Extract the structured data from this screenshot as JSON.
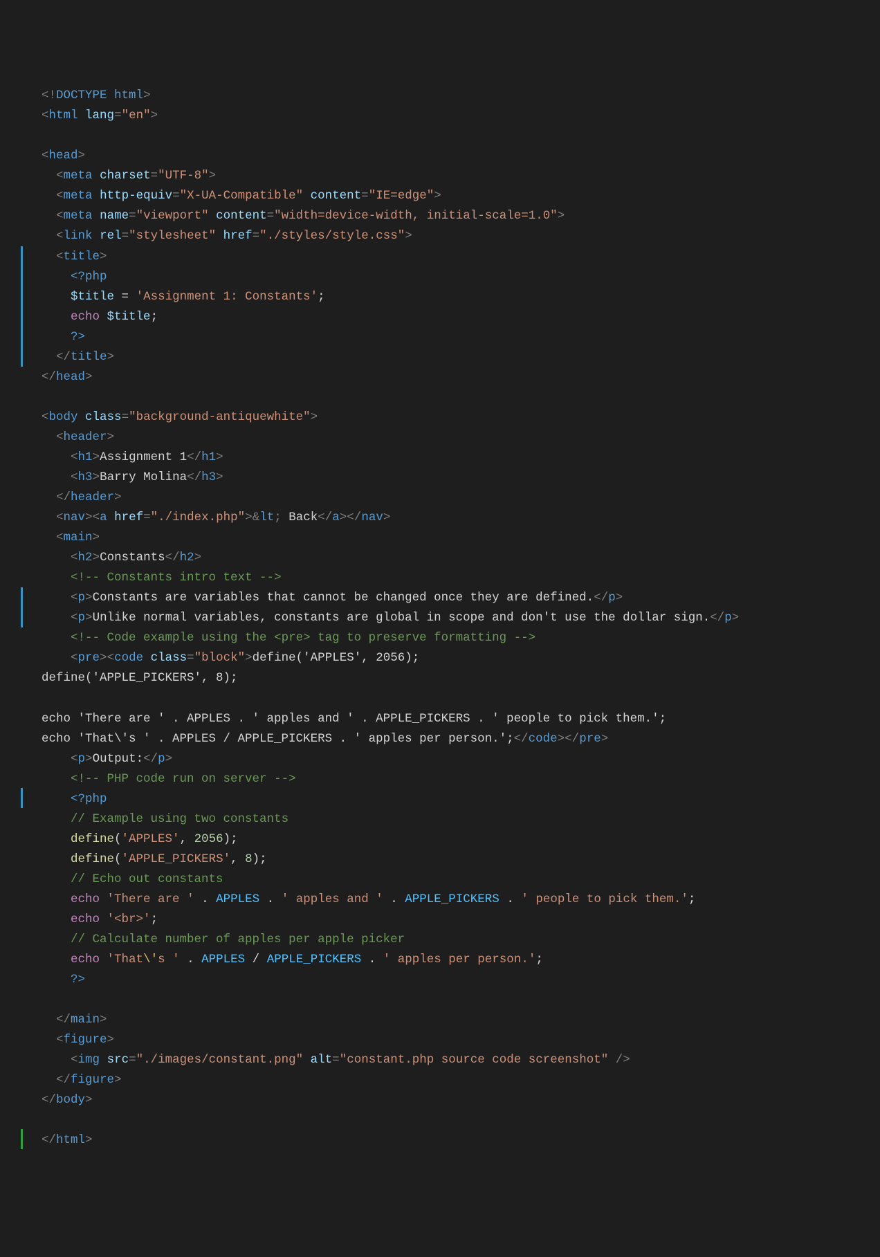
{
  "lines": [
    {
      "i": 0,
      "seg": [
        [
          "t-punc",
          "<!"
        ],
        [
          "t-doct",
          "DOCTYPE"
        ],
        [
          "t-text",
          " "
        ],
        [
          "t-doct",
          "html"
        ],
        [
          "t-punc",
          ">"
        ]
      ]
    },
    {
      "i": 0,
      "seg": [
        [
          "t-punc",
          "<"
        ],
        [
          "t-tag",
          "html"
        ],
        [
          "t-text",
          " "
        ],
        [
          "t-attr",
          "lang"
        ],
        [
          "t-punc",
          "="
        ],
        [
          "t-str",
          "\"en\""
        ],
        [
          "t-punc",
          ">"
        ]
      ]
    },
    {
      "i": 0,
      "seg": []
    },
    {
      "i": 0,
      "seg": [
        [
          "t-punc",
          "<"
        ],
        [
          "t-tag",
          "head"
        ],
        [
          "t-punc",
          ">"
        ]
      ]
    },
    {
      "i": 1,
      "seg": [
        [
          "t-punc",
          "<"
        ],
        [
          "t-tag",
          "meta"
        ],
        [
          "t-text",
          " "
        ],
        [
          "t-attr",
          "charset"
        ],
        [
          "t-punc",
          "="
        ],
        [
          "t-str",
          "\"UTF-8\""
        ],
        [
          "t-punc",
          ">"
        ]
      ]
    },
    {
      "i": 1,
      "seg": [
        [
          "t-punc",
          "<"
        ],
        [
          "t-tag",
          "meta"
        ],
        [
          "t-text",
          " "
        ],
        [
          "t-attr",
          "http-equiv"
        ],
        [
          "t-punc",
          "="
        ],
        [
          "t-str",
          "\"X-UA-Compatible\""
        ],
        [
          "t-text",
          " "
        ],
        [
          "t-attr",
          "content"
        ],
        [
          "t-punc",
          "="
        ],
        [
          "t-str",
          "\"IE=edge\""
        ],
        [
          "t-punc",
          ">"
        ]
      ]
    },
    {
      "i": 1,
      "seg": [
        [
          "t-punc",
          "<"
        ],
        [
          "t-tag",
          "meta"
        ],
        [
          "t-text",
          " "
        ],
        [
          "t-attr",
          "name"
        ],
        [
          "t-punc",
          "="
        ],
        [
          "t-str",
          "\"viewport\""
        ],
        [
          "t-text",
          " "
        ],
        [
          "t-attr",
          "content"
        ],
        [
          "t-punc",
          "="
        ],
        [
          "t-str",
          "\"width=device-width, initial-scale=1.0\""
        ],
        [
          "t-punc",
          ">"
        ]
      ]
    },
    {
      "i": 1,
      "seg": [
        [
          "t-punc",
          "<"
        ],
        [
          "t-tag",
          "link"
        ],
        [
          "t-text",
          " "
        ],
        [
          "t-attr",
          "rel"
        ],
        [
          "t-punc",
          "="
        ],
        [
          "t-str",
          "\"stylesheet\""
        ],
        [
          "t-text",
          " "
        ],
        [
          "t-attr",
          "href"
        ],
        [
          "t-punc",
          "="
        ],
        [
          "t-str",
          "\"./styles/style.css\""
        ],
        [
          "t-punc",
          ">"
        ]
      ]
    },
    {
      "i": 1,
      "seg": [
        [
          "t-punc",
          "<"
        ],
        [
          "t-tag",
          "title"
        ],
        [
          "t-punc",
          ">"
        ]
      ]
    },
    {
      "i": 2,
      "seg": [
        [
          "t-php",
          "<?php"
        ]
      ]
    },
    {
      "i": 2,
      "seg": [
        [
          "t-var",
          "$title"
        ],
        [
          "t-text",
          " "
        ],
        [
          "t-op",
          "="
        ],
        [
          "t-text",
          " "
        ],
        [
          "t-str",
          "'Assignment 1: Constants'"
        ],
        [
          "t-text",
          ";"
        ]
      ]
    },
    {
      "i": 2,
      "seg": [
        [
          "t-kw",
          "echo"
        ],
        [
          "t-text",
          " "
        ],
        [
          "t-var",
          "$title"
        ],
        [
          "t-text",
          ";"
        ]
      ]
    },
    {
      "i": 2,
      "seg": [
        [
          "t-php",
          "?>"
        ]
      ]
    },
    {
      "i": 1,
      "seg": [
        [
          "t-punc",
          "</"
        ],
        [
          "t-tag",
          "title"
        ],
        [
          "t-punc",
          ">"
        ]
      ]
    },
    {
      "i": 0,
      "seg": [
        [
          "t-punc",
          "</"
        ],
        [
          "t-tag",
          "head"
        ],
        [
          "t-punc",
          ">"
        ]
      ]
    },
    {
      "i": 0,
      "seg": []
    },
    {
      "i": 0,
      "seg": [
        [
          "t-punc",
          "<"
        ],
        [
          "t-tag",
          "body"
        ],
        [
          "t-text",
          " "
        ],
        [
          "t-attr",
          "class"
        ],
        [
          "t-punc",
          "="
        ],
        [
          "t-str",
          "\"background-antiquewhite\""
        ],
        [
          "t-punc",
          ">"
        ]
      ]
    },
    {
      "i": 1,
      "seg": [
        [
          "t-punc",
          "<"
        ],
        [
          "t-tag",
          "header"
        ],
        [
          "t-punc",
          ">"
        ]
      ]
    },
    {
      "i": 2,
      "seg": [
        [
          "t-punc",
          "<"
        ],
        [
          "t-tag",
          "h1"
        ],
        [
          "t-punc",
          ">"
        ],
        [
          "t-text",
          "Assignment 1"
        ],
        [
          "t-punc",
          "</"
        ],
        [
          "t-tag",
          "h1"
        ],
        [
          "t-punc",
          ">"
        ]
      ]
    },
    {
      "i": 2,
      "seg": [
        [
          "t-punc",
          "<"
        ],
        [
          "t-tag",
          "h3"
        ],
        [
          "t-punc",
          ">"
        ],
        [
          "t-text",
          "Barry Molina"
        ],
        [
          "t-punc",
          "</"
        ],
        [
          "t-tag",
          "h3"
        ],
        [
          "t-punc",
          ">"
        ]
      ]
    },
    {
      "i": 1,
      "seg": [
        [
          "t-punc",
          "</"
        ],
        [
          "t-tag",
          "header"
        ],
        [
          "t-punc",
          ">"
        ]
      ]
    },
    {
      "i": 1,
      "seg": [
        [
          "t-punc",
          "<"
        ],
        [
          "t-tag",
          "nav"
        ],
        [
          "t-punc",
          ">"
        ],
        [
          "t-punc",
          "<"
        ],
        [
          "t-tag",
          "a"
        ],
        [
          "t-text",
          " "
        ],
        [
          "t-attr",
          "href"
        ],
        [
          "t-punc",
          "="
        ],
        [
          "t-str",
          "\"./index.php\""
        ],
        [
          "t-punc",
          ">"
        ],
        [
          "t-punc",
          "&"
        ],
        [
          "t-ent",
          "lt"
        ],
        [
          "t-punc",
          ";"
        ],
        [
          "t-text",
          " Back"
        ],
        [
          "t-punc",
          "</"
        ],
        [
          "t-tag",
          "a"
        ],
        [
          "t-punc",
          ">"
        ],
        [
          "t-punc",
          "</"
        ],
        [
          "t-tag",
          "nav"
        ],
        [
          "t-punc",
          ">"
        ]
      ]
    },
    {
      "i": 1,
      "seg": [
        [
          "t-punc",
          "<"
        ],
        [
          "t-tag",
          "main"
        ],
        [
          "t-punc",
          ">"
        ]
      ]
    },
    {
      "i": 2,
      "seg": [
        [
          "t-punc",
          "<"
        ],
        [
          "t-tag",
          "h2"
        ],
        [
          "t-punc",
          ">"
        ],
        [
          "t-text",
          "Constants"
        ],
        [
          "t-punc",
          "</"
        ],
        [
          "t-tag",
          "h2"
        ],
        [
          "t-punc",
          ">"
        ]
      ]
    },
    {
      "i": 2,
      "seg": [
        [
          "t-com",
          "<!-- Constants intro text -->"
        ]
      ]
    },
    {
      "i": 2,
      "seg": [
        [
          "t-punc",
          "<"
        ],
        [
          "t-tag",
          "p"
        ],
        [
          "t-punc",
          ">"
        ],
        [
          "t-text",
          "Constants are variables that cannot be changed once they are defined."
        ],
        [
          "t-punc",
          "</"
        ],
        [
          "t-tag",
          "p"
        ],
        [
          "t-punc",
          ">"
        ]
      ]
    },
    {
      "i": 2,
      "seg": [
        [
          "t-punc",
          "<"
        ],
        [
          "t-tag",
          "p"
        ],
        [
          "t-punc",
          ">"
        ],
        [
          "t-text",
          "Unlike normal variables, constants are global in scope and don't use the dollar sign."
        ],
        [
          "t-punc",
          "</"
        ],
        [
          "t-tag",
          "p"
        ],
        [
          "t-punc",
          ">"
        ]
      ]
    },
    {
      "i": 2,
      "seg": [
        [
          "t-com",
          "<!-- Code example using the <pre> tag to preserve formatting -->"
        ]
      ]
    },
    {
      "i": 2,
      "seg": [
        [
          "t-punc",
          "<"
        ],
        [
          "t-tag",
          "pre"
        ],
        [
          "t-punc",
          ">"
        ],
        [
          "t-punc",
          "<"
        ],
        [
          "t-tag",
          "code"
        ],
        [
          "t-text",
          " "
        ],
        [
          "t-attr",
          "class"
        ],
        [
          "t-punc",
          "="
        ],
        [
          "t-str",
          "\"block\""
        ],
        [
          "t-punc",
          ">"
        ],
        [
          "t-text",
          "define('APPLES', 2056);"
        ]
      ]
    },
    {
      "i": -1,
      "seg": [
        [
          "t-text",
          "define('APPLE_PICKERS', 8);"
        ]
      ]
    },
    {
      "i": -1,
      "seg": []
    },
    {
      "i": -1,
      "seg": [
        [
          "t-text",
          "echo 'There are ' . APPLES . ' apples and ' . APPLE_PICKERS . ' people to pick them.';"
        ]
      ]
    },
    {
      "i": -1,
      "seg": [
        [
          "t-text",
          "echo 'That\\'s ' . APPLES / APPLE_PICKERS . ' apples per person.';"
        ],
        [
          "t-punc",
          "</"
        ],
        [
          "t-tag",
          "code"
        ],
        [
          "t-punc",
          ">"
        ],
        [
          "t-punc",
          "</"
        ],
        [
          "t-tag",
          "pre"
        ],
        [
          "t-punc",
          ">"
        ]
      ]
    },
    {
      "i": 2,
      "seg": [
        [
          "t-punc",
          "<"
        ],
        [
          "t-tag",
          "p"
        ],
        [
          "t-punc",
          ">"
        ],
        [
          "t-text",
          "Output:"
        ],
        [
          "t-punc",
          "</"
        ],
        [
          "t-tag",
          "p"
        ],
        [
          "t-punc",
          ">"
        ]
      ]
    },
    {
      "i": 2,
      "seg": [
        [
          "t-com",
          "<!-- PHP code run on server -->"
        ]
      ]
    },
    {
      "i": 2,
      "seg": [
        [
          "t-php",
          "<?php"
        ]
      ]
    },
    {
      "i": 2,
      "seg": [
        [
          "t-com",
          "// Example using two constants"
        ]
      ]
    },
    {
      "i": 2,
      "seg": [
        [
          "t-func",
          "define"
        ],
        [
          "t-text",
          "("
        ],
        [
          "t-str",
          "'APPLES'"
        ],
        [
          "t-text",
          ", "
        ],
        [
          "t-num",
          "2056"
        ],
        [
          "t-text",
          ");"
        ]
      ]
    },
    {
      "i": 2,
      "seg": [
        [
          "t-func",
          "define"
        ],
        [
          "t-text",
          "("
        ],
        [
          "t-str",
          "'APPLE_PICKERS'"
        ],
        [
          "t-text",
          ", "
        ],
        [
          "t-num",
          "8"
        ],
        [
          "t-text",
          ");"
        ]
      ]
    },
    {
      "i": 2,
      "seg": [
        [
          "t-com",
          "// Echo out constants"
        ]
      ]
    },
    {
      "i": 2,
      "seg": [
        [
          "t-kw",
          "echo"
        ],
        [
          "t-text",
          " "
        ],
        [
          "t-str",
          "'There are '"
        ],
        [
          "t-text",
          " "
        ],
        [
          "t-op",
          "."
        ],
        [
          "t-text",
          " "
        ],
        [
          "t-const",
          "APPLES"
        ],
        [
          "t-text",
          " "
        ],
        [
          "t-op",
          "."
        ],
        [
          "t-text",
          " "
        ],
        [
          "t-str",
          "' apples and '"
        ],
        [
          "t-text",
          " "
        ],
        [
          "t-op",
          "."
        ],
        [
          "t-text",
          " "
        ],
        [
          "t-const",
          "APPLE_PICKERS"
        ],
        [
          "t-text",
          " "
        ],
        [
          "t-op",
          "."
        ],
        [
          "t-text",
          " "
        ],
        [
          "t-str",
          "' people to pick them.'"
        ],
        [
          "t-text",
          ";"
        ]
      ]
    },
    {
      "i": 2,
      "seg": [
        [
          "t-kw",
          "echo"
        ],
        [
          "t-text",
          " "
        ],
        [
          "t-str",
          "'<br>'"
        ],
        [
          "t-text",
          ";"
        ]
      ]
    },
    {
      "i": 2,
      "seg": [
        [
          "t-com",
          "// Calculate number of apples per apple picker"
        ]
      ]
    },
    {
      "i": 2,
      "seg": [
        [
          "t-kw",
          "echo"
        ],
        [
          "t-text",
          " "
        ],
        [
          "t-str",
          "'That"
        ],
        [
          "t-esc",
          "\\'"
        ],
        [
          "t-str",
          "s '"
        ],
        [
          "t-text",
          " "
        ],
        [
          "t-op",
          "."
        ],
        [
          "t-text",
          " "
        ],
        [
          "t-const",
          "APPLES"
        ],
        [
          "t-text",
          " "
        ],
        [
          "t-op",
          "/"
        ],
        [
          "t-text",
          " "
        ],
        [
          "t-const",
          "APPLE_PICKERS"
        ],
        [
          "t-text",
          " "
        ],
        [
          "t-op",
          "."
        ],
        [
          "t-text",
          " "
        ],
        [
          "t-str",
          "' apples per person.'"
        ],
        [
          "t-text",
          ";"
        ]
      ]
    },
    {
      "i": 2,
      "seg": [
        [
          "t-php",
          "?>"
        ]
      ]
    },
    {
      "i": 2,
      "seg": []
    },
    {
      "i": 1,
      "seg": [
        [
          "t-punc",
          "</"
        ],
        [
          "t-tag",
          "main"
        ],
        [
          "t-punc",
          ">"
        ]
      ]
    },
    {
      "i": 1,
      "seg": [
        [
          "t-punc",
          "<"
        ],
        [
          "t-tag",
          "figure"
        ],
        [
          "t-punc",
          ">"
        ]
      ]
    },
    {
      "i": 2,
      "seg": [
        [
          "t-punc",
          "<"
        ],
        [
          "t-tag",
          "img"
        ],
        [
          "t-text",
          " "
        ],
        [
          "t-attr",
          "src"
        ],
        [
          "t-punc",
          "="
        ],
        [
          "t-str",
          "\"./images/constant.png\""
        ],
        [
          "t-text",
          " "
        ],
        [
          "t-attr",
          "alt"
        ],
        [
          "t-punc",
          "="
        ],
        [
          "t-str",
          "\"constant.php source code screenshot\""
        ],
        [
          "t-text",
          " "
        ],
        [
          "t-punc",
          "/>"
        ]
      ]
    },
    {
      "i": 1,
      "seg": [
        [
          "t-punc",
          "</"
        ],
        [
          "t-tag",
          "figure"
        ],
        [
          "t-punc",
          ">"
        ]
      ]
    },
    {
      "i": 0,
      "seg": [
        [
          "t-punc",
          "</"
        ],
        [
          "t-tag",
          "body"
        ],
        [
          "t-punc",
          ">"
        ]
      ]
    },
    {
      "i": 0,
      "seg": []
    },
    {
      "i": 0,
      "seg": [
        [
          "t-punc",
          "</"
        ],
        [
          "t-tag",
          "html"
        ],
        [
          "t-punc",
          ">"
        ]
      ]
    }
  ],
  "gutter_bars": [
    {
      "start": 8,
      "end": 13,
      "color": "#3794c4"
    },
    {
      "start": 25,
      "end": 26,
      "color": "#3794c4"
    },
    {
      "start": 35,
      "end": 35,
      "color": "#3794c4"
    },
    {
      "start": 52,
      "end": 52,
      "color": "#2ea043"
    }
  ],
  "indent_guides": true,
  "indent_unit": "  "
}
